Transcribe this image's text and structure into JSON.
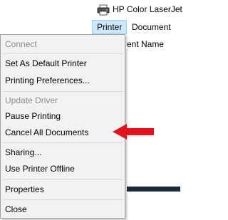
{
  "window": {
    "title": "HP Color LaserJet",
    "icon": "printer-icon"
  },
  "menubar": {
    "items": [
      {
        "label": "Printer",
        "active": true
      },
      {
        "label": "Document",
        "active": false
      }
    ]
  },
  "list": {
    "column_header_visible": "ent Name"
  },
  "printer_menu": {
    "items": [
      {
        "label": "Connect",
        "enabled": false
      },
      {
        "label": "Set As Default Printer",
        "enabled": true
      },
      {
        "label": "Printing Preferences...",
        "enabled": true
      },
      {
        "label": "Update Driver",
        "enabled": false
      },
      {
        "label": "Pause Printing",
        "enabled": true
      },
      {
        "label": "Cancel All Documents",
        "enabled": true
      },
      {
        "label": "Sharing...",
        "enabled": true
      },
      {
        "label": "Use Printer Offline",
        "enabled": true
      },
      {
        "label": "Properties",
        "enabled": true
      },
      {
        "label": "Close",
        "enabled": true
      }
    ]
  },
  "annotation": {
    "type": "arrow",
    "color": "#e3121b",
    "points_to": "Cancel All Documents"
  },
  "colors": {
    "menu_background": "#f2f2f2",
    "active_menu_highlight": "#cce8ff",
    "disabled_text": "#8c8c8c"
  }
}
